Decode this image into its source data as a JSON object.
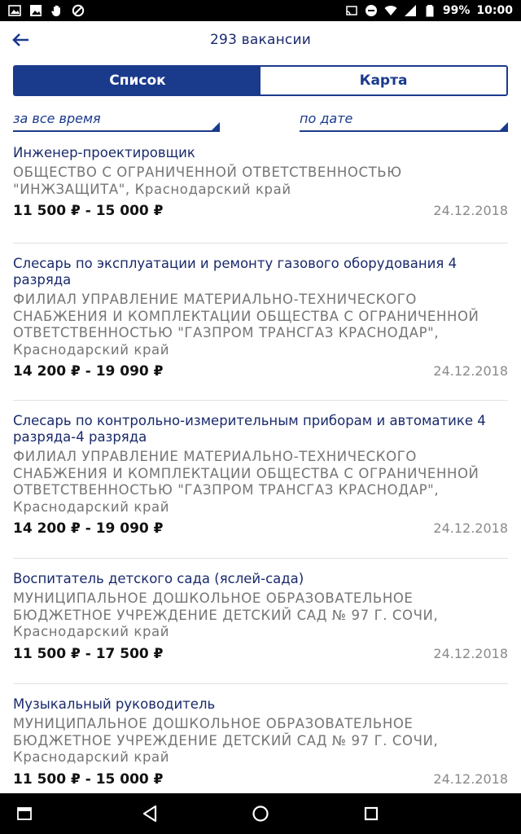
{
  "status_bar": {
    "battery": "99%",
    "time": "10:00"
  },
  "header": {
    "title": "293 вакансии"
  },
  "tabs": [
    {
      "label": "Список",
      "active": true
    },
    {
      "label": "Карта",
      "active": false
    }
  ],
  "filters": {
    "period": "за все время",
    "sort": "по дате"
  },
  "jobs": [
    {
      "title": "Инженер-проектировщик",
      "org": "ОБЩЕСТВО С ОГРАНИЧЕННОЙ ОТВЕТСТВЕННОСТЬЮ \"ИНЖЗАЩИТА\", Краснодарский край",
      "salary": "11 500 ₽ - 15 000 ₽",
      "date": "24.12.2018"
    },
    {
      "title": "Слесарь по эксплуатации и ремонту газового оборудования 4 разряда",
      "org": "ФИЛИАЛ УПРАВЛЕНИЕ МАТЕРИАЛЬНО-ТЕХНИЧЕСКОГО СНАБЖЕНИЯ И КОМПЛЕКТАЦИИ ОБЩЕСТВА С ОГРАНИЧЕННОЙ ОТВЕТСТВЕННОСТЬЮ \"ГАЗПРОМ ТРАНСГАЗ КРАСНОДАР\", Краснодарский край",
      "salary": "14 200 ₽ - 19 090 ₽",
      "date": "24.12.2018"
    },
    {
      "title": "Слесарь по контрольно-измерительным приборам и автоматике 4 разряда-4 разряда",
      "org": "ФИЛИАЛ УПРАВЛЕНИЕ МАТЕРИАЛЬНО-ТЕХНИЧЕСКОГО СНАБЖЕНИЯ И КОМПЛЕКТАЦИИ ОБЩЕСТВА С ОГРАНИЧЕННОЙ ОТВЕТСТВЕННОСТЬЮ \"ГАЗПРОМ ТРАНСГАЗ КРАСНОДАР\", Краснодарский край",
      "salary": "14 200 ₽ - 19 090 ₽",
      "date": "24.12.2018"
    },
    {
      "title": "Воспитатель детского сада (яслей-сада)",
      "org": "МУНИЦИПАЛЬНОЕ ДОШКОЛЬНОЕ ОБРАЗОВАТЕЛЬНОЕ БЮДЖЕТНОЕ УЧРЕЖДЕНИЕ ДЕТСКИЙ САД № 97 Г. СОЧИ, Краснодарский край",
      "salary": "11 500 ₽ - 17 500 ₽",
      "date": "24.12.2018"
    },
    {
      "title": "Музыкальный руководитель",
      "org": "МУНИЦИПАЛЬНОЕ ДОШКОЛЬНОЕ ОБРАЗОВАТЕЛЬНОЕ БЮДЖЕТНОЕ УЧРЕЖДЕНИЕ ДЕТСКИЙ САД № 97 Г. СОЧИ, Краснодарский край",
      "salary": "11 500 ₽ - 15 000 ₽",
      "date": "24.12.2018"
    }
  ],
  "icons": {
    "back": "arrow-left-icon",
    "nav_recents": "recents-window-icon",
    "nav_back": "triangle-back-icon",
    "nav_home": "circle-home-icon",
    "nav_overview": "square-overview-icon"
  },
  "colors": {
    "accent": "#1a3a8c",
    "title_text": "#1a2a6c",
    "secondary_text": "#757575"
  }
}
